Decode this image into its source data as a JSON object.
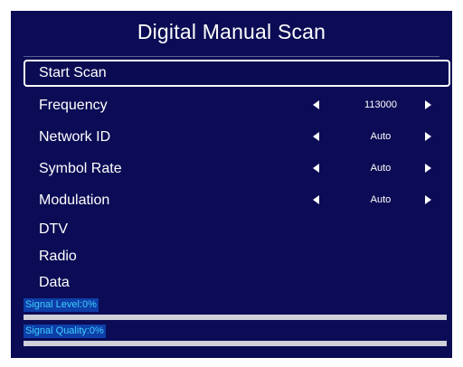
{
  "title": "Digital Manual Scan",
  "menu": {
    "start_scan": "Start Scan",
    "frequency": {
      "label": "Frequency",
      "value": "113000"
    },
    "network_id": {
      "label": "Network ID",
      "value": "Auto"
    },
    "symbol_rate": {
      "label": "Symbol Rate",
      "value": "Auto"
    },
    "modulation": {
      "label": "Modulation",
      "value": "Auto"
    },
    "dtv": "DTV",
    "radio": "Radio",
    "data": "Data"
  },
  "signal": {
    "level_label": "Signal Level:0%",
    "level_percent": 0,
    "quality_label": "Signal Quality:0%",
    "quality_percent": 0
  },
  "icons": {
    "left": "left-arrow-icon",
    "right": "right-arrow-icon"
  },
  "colors": {
    "background": "#0b0c55",
    "text": "#ffffff",
    "meter_text": "#3fd0ff",
    "meter_bar": "#cfd0d8"
  }
}
